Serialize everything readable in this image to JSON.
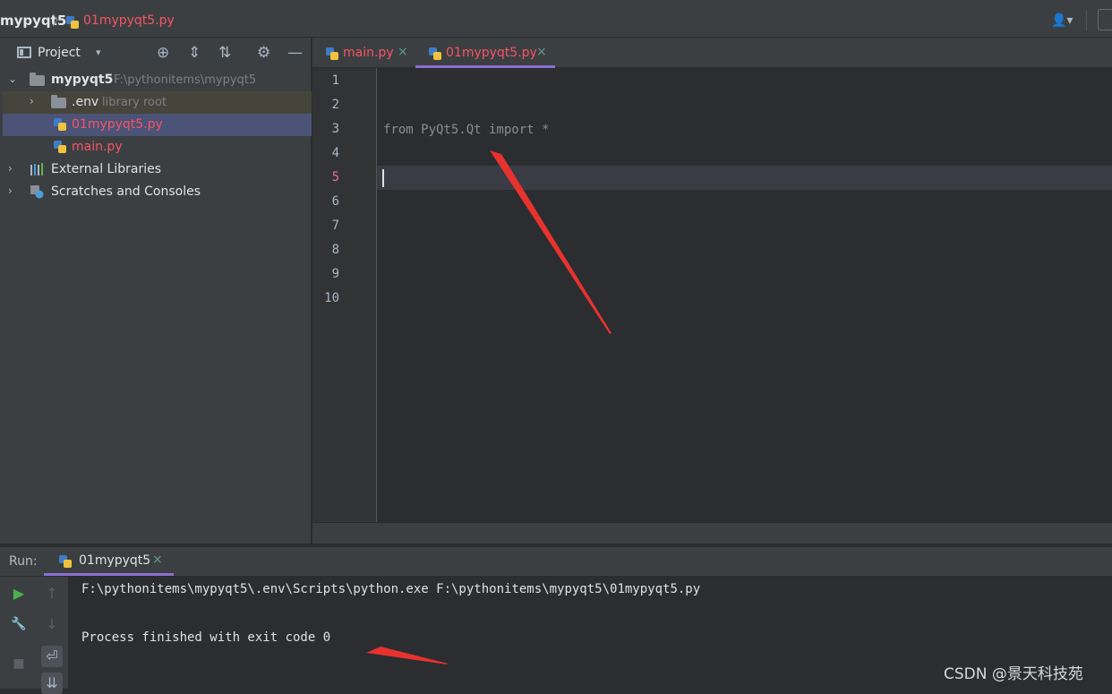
{
  "breadcrumb": {
    "project": "mypyqt5",
    "separator": "〉",
    "file": "01mypyqt5.py"
  },
  "toolbar": {
    "user_icon": "person-icon",
    "user_glyph": "👤▾"
  },
  "project_panel": {
    "title": "Project",
    "dropdown": "▾",
    "tools": [
      "⊕",
      "⇕",
      "⇅",
      "⚙",
      "—"
    ],
    "tree": [
      {
        "name": "mypyqt5",
        "path": "F:\\pythonitems\\mypyqt5",
        "expanded": "⌄"
      },
      {
        "name": ".env",
        "note": "library root",
        "arrow": "›"
      },
      {
        "name": "01mypyqt5.py"
      },
      {
        "name": "main.py"
      },
      {
        "name": "External Libraries",
        "arrow": "›"
      },
      {
        "name": "Scratches and Consoles",
        "arrow": "›"
      }
    ]
  },
  "editor": {
    "tabs": [
      {
        "label": "main.py",
        "close": "×"
      },
      {
        "label": "01mypyqt5.py",
        "close": "×"
      }
    ],
    "line_numbers": [
      "1",
      "2",
      "3",
      "4",
      "5",
      "6",
      "7",
      "8",
      "9",
      "10"
    ],
    "current_line": "5",
    "code_line_3": "from PyQt5.Qt import *"
  },
  "run": {
    "label": "Run:",
    "tab_label": "01mypyqt5",
    "tab_close": "×",
    "console": [
      "F:\\pythonitems\\mypyqt5\\.env\\Scripts\\python.exe F:\\pythonitems\\mypyqt5\\01mypyqt5.py",
      "Process finished with exit code 0"
    ],
    "buttons": [
      "▶",
      "↑",
      "🔧",
      "↓",
      "■",
      "⏎",
      "⇊"
    ]
  },
  "watermark": "CSDN @景天科技苑",
  "colors": {
    "accent": "#8a6fd1",
    "error_red": "#f75464",
    "arrow_red": "#e8322e"
  }
}
